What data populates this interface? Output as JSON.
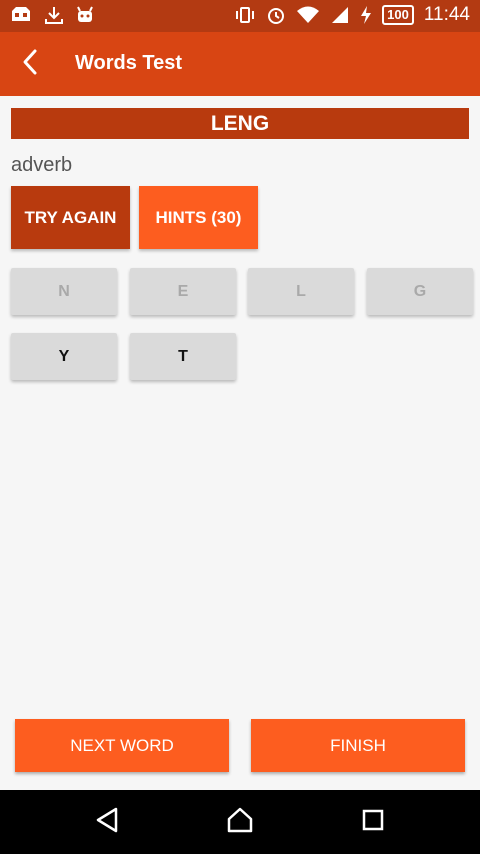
{
  "status_bar": {
    "battery": "100",
    "time": "11:44",
    "icons": [
      "game-controller-icon",
      "download-icon",
      "android-icon",
      "vibrate-icon",
      "alarm-icon",
      "wifi-icon",
      "signal-icon",
      "charging-icon",
      "battery-icon"
    ]
  },
  "app_bar": {
    "title": "Words Test",
    "back_icon": "back-arrow-icon"
  },
  "quiz": {
    "answer": "LENG",
    "word_type": "adverb",
    "try_again_label": "TRY AGAIN",
    "hints_label": "HINTS (30)",
    "tiles": [
      {
        "letter": "N",
        "used": true
      },
      {
        "letter": "E",
        "used": true
      },
      {
        "letter": "L",
        "used": true
      },
      {
        "letter": "G",
        "used": true
      },
      {
        "letter": "Y",
        "used": false
      },
      {
        "letter": "T",
        "used": false
      }
    ]
  },
  "footer": {
    "next_word_label": "NEXT WORD",
    "finish_label": "FINISH"
  },
  "nav_bar": {
    "icons": [
      "back-triangle-icon",
      "home-icon",
      "recents-icon"
    ]
  },
  "colors": {
    "status_bar": "#b33a12",
    "app_bar": "#d84513",
    "dark_accent": "#b83a0e",
    "accent": "#fd5d1f",
    "tile_bg": "#dadada"
  }
}
